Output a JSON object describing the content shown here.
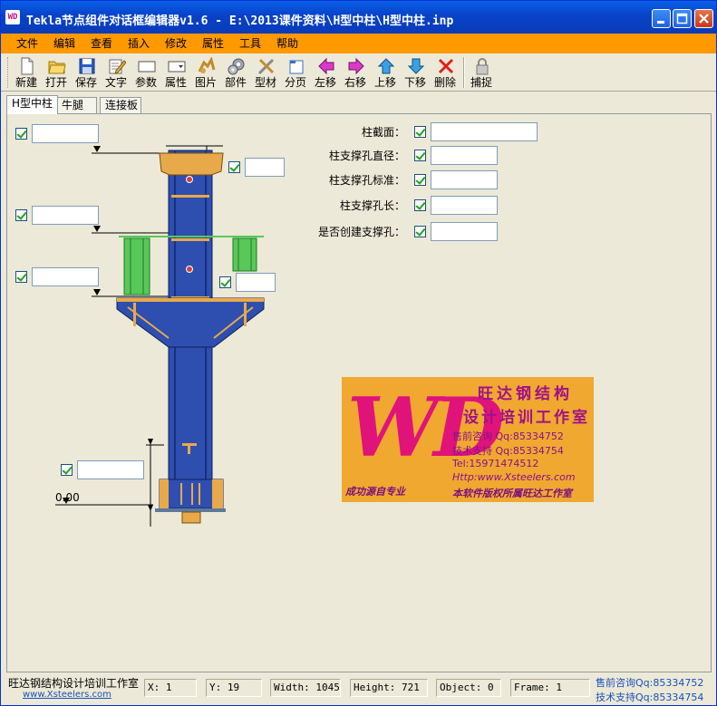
{
  "window": {
    "title": "Tekla节点组件对话框编辑器v1.6 - E:\\2013课件资料\\H型中柱\\H型中柱.inp",
    "app_icon": "WD",
    "minimize_icon": "minimize-icon",
    "maximize_icon": "maximize-icon",
    "close_icon": "close-icon"
  },
  "menu": [
    "文件",
    "编辑",
    "查看",
    "插入",
    "修改",
    "属性",
    "工具",
    "帮助"
  ],
  "toolbar": [
    {
      "label": "新建",
      "icon": "new-file-icon"
    },
    {
      "label": "打开",
      "icon": "open-folder-icon"
    },
    {
      "label": "保存",
      "icon": "save-disk-icon"
    },
    {
      "label": "文字",
      "icon": "text-pencil-icon"
    },
    {
      "label": "参数",
      "icon": "parameter-field-icon"
    },
    {
      "label": "属性",
      "icon": "attribute-dropdown-icon"
    },
    {
      "label": "图片",
      "icon": "picture-icon"
    },
    {
      "label": "部件",
      "icon": "component-gear-icon"
    },
    {
      "label": "型材",
      "icon": "profile-tools-icon"
    },
    {
      "label": "分页",
      "icon": "new-page-icon"
    },
    {
      "label": "左移",
      "icon": "arrow-left-icon"
    },
    {
      "label": "右移",
      "icon": "arrow-right-icon"
    },
    {
      "label": "上移",
      "icon": "arrow-up-icon"
    },
    {
      "label": "下移",
      "icon": "arrow-down-icon"
    },
    {
      "label": "删除",
      "icon": "delete-x-icon"
    },
    {
      "label": "捕捉",
      "icon": "snap-lock-icon"
    }
  ],
  "tabs": [
    "H型中柱",
    "牛腿",
    "连接板"
  ],
  "properties": [
    {
      "label": "柱截面：",
      "value": ""
    },
    {
      "label": "柱支撑孔直径：",
      "value": ""
    },
    {
      "label": "柱支撑孔标准：",
      "value": ""
    },
    {
      "label": "柱支撑孔长：",
      "value": ""
    },
    {
      "label": "是否创建支撑孔：",
      "value": ""
    }
  ],
  "drawing": {
    "dimension_value": "0.00"
  },
  "logo": {
    "mark": "WD",
    "title_line1": "旺达钢结构",
    "title_line2": "设计培训工作室",
    "presale": "售前咨询 Qq:85334752",
    "support": "技术支持 Qq:85334754",
    "tel": "Tel:15971474512",
    "web": "Http:www.Xsteelers.com",
    "slogan_left": "成功源自专业",
    "slogan_right": "本软件版权所属旺达工作室"
  },
  "status": {
    "company": "旺达钢结构设计培训工作室",
    "website": "www.Xsteelers.com",
    "x": "X: 1",
    "y": "Y: 19",
    "width": "Width: 1045",
    "height": "Height: 721",
    "object": "Object: 0",
    "frame": "Frame: 1",
    "presale": "售前咨询Qq:85334752",
    "support": "技术支持Qq:85334754"
  },
  "colors": {
    "menu_bg": "#FF9900",
    "column_blue": "#2E4FAF",
    "steel_yellow": "#E8A94A",
    "bracket_green": "#58C85A",
    "logo_bg": "#F0A830",
    "logo_magenta": "#E0137B",
    "link_blue": "#1A50B8"
  }
}
